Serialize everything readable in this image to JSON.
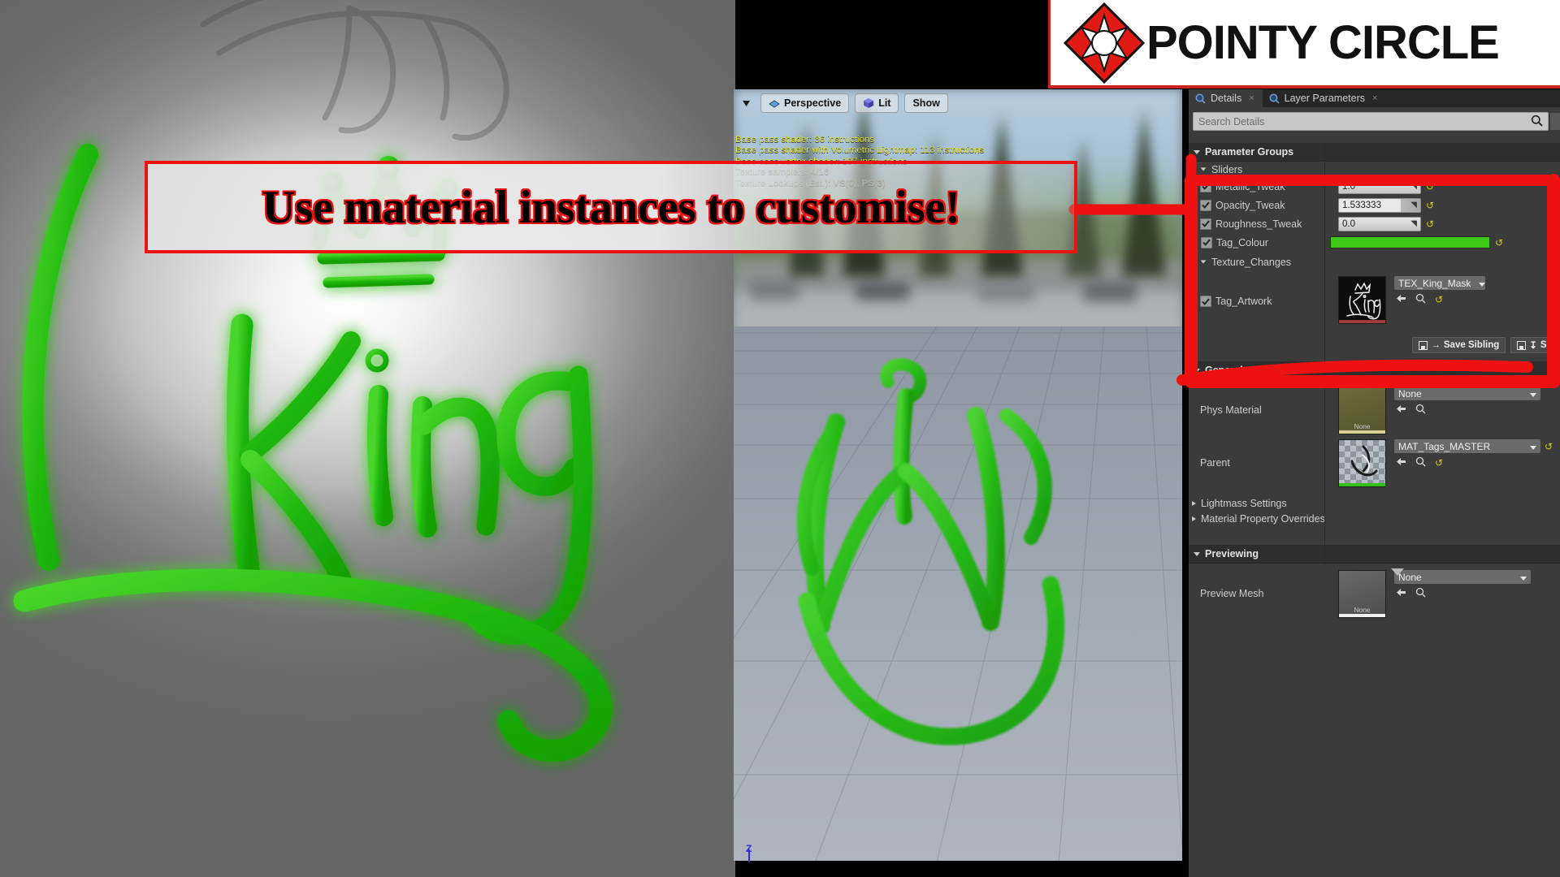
{
  "branding": {
    "company": "POINTY CIRCLE",
    "logo_icon": "pointy-circle-diamond-star-logo"
  },
  "annotation": {
    "banner_text": "Use material instances to customise!",
    "accent_color": "#ee1111",
    "callout_label": "red-highlight-box-around-parameter-groups"
  },
  "viewport": {
    "toolbar": {
      "dropdown_icon": "viewport-options-caret",
      "camera_label": "Perspective",
      "camera_icon": "perspective-camera-icon",
      "lighting_label": "Lit",
      "lighting_icon": "lit-cube-icon",
      "show_label": "Show"
    },
    "stats": [
      {
        "text": "Base pass shader: 86 instructions",
        "dim": false
      },
      {
        "text": "Base pass shader with Volumetric Lightmap: 113 instructions",
        "dim": false
      },
      {
        "text": "Base pass vertex shader: 197 instructions",
        "dim": false
      },
      {
        "text": "Texture samplers: 4/16",
        "dim": true
      },
      {
        "text": "Texture Lookups (Est.): VS(0), PS(3)",
        "dim": true
      }
    ],
    "axis_label": "Z"
  },
  "panel": {
    "tabs": [
      {
        "label": "Details",
        "icon": "search-magnifier-tab-icon",
        "active": true,
        "close": "×"
      },
      {
        "label": "Layer Parameters",
        "icon": "search-magnifier-tab-icon",
        "active": false,
        "close": "×"
      }
    ],
    "search": {
      "placeholder": "Search Details",
      "value": "",
      "icon": "search-icon"
    },
    "sections": {
      "parameter_groups": {
        "title": "Parameter Groups",
        "groups": [
          {
            "title": "Sliders",
            "rows": [
              {
                "label": "Metallic_Tweak",
                "checked": true,
                "type": "number",
                "value": "1.0",
                "fill": 1.0,
                "revert": true
              },
              {
                "label": "Opacity_Tweak",
                "checked": true,
                "type": "number",
                "value": "1.533333",
                "fill": 0.76,
                "revert": true
              },
              {
                "label": "Roughness_Tweak",
                "checked": true,
                "type": "number",
                "value": "0.0",
                "fill": 1.0,
                "revert": true
              }
            ],
            "color_row": {
              "label": "Tag_Colour",
              "checked": true,
              "expandable": true,
              "color": "#3cc716",
              "revert": true
            }
          },
          {
            "title": "Texture_Changes",
            "texture_row": {
              "label": "Tag_Artwork",
              "checked": true,
              "asset_name": "TEX_King_Mask",
              "thumb_name": "king-graffiti-tag-thumbnail",
              "thumb_strip_color": "#9e3b3b",
              "actions": [
                "browse-to-asset-icon",
                "find-in-content-browser-icon",
                "reset-to-default-icon"
              ]
            }
          }
        ],
        "buttons": [
          {
            "label": "Save Sibling",
            "icon": "save-sibling-icon"
          },
          {
            "label": "Sa",
            "icon": "save-child-icon"
          }
        ]
      },
      "general": {
        "title": "General",
        "rows": [
          {
            "label": "Phys Material",
            "thumb_caption": "None",
            "thumb_strip_color": "#d9cf92",
            "thumb_name": "phys-material-thumbnail",
            "value": "None",
            "actions": [
              "browse-to-asset-icon",
              "find-in-content-browser-icon"
            ],
            "revert": false
          },
          {
            "label": "Parent",
            "thumb_caption": "",
            "thumb_strip_color": "#2fc21a",
            "thumb_name": "parent-material-thumbnail",
            "value": "MAT_Tags_MASTER",
            "actions": [
              "browse-to-asset-icon",
              "find-in-content-browser-icon",
              "reset-to-default-icon"
            ],
            "revert": true
          }
        ],
        "collapsed": [
          {
            "label": "Lightmass Settings"
          },
          {
            "label": "Material Property Overrides"
          }
        ]
      },
      "previewing": {
        "title": "Previewing",
        "rows": [
          {
            "label": "Preview Mesh",
            "thumb_caption": "None",
            "thumb_strip_color": "#f0f0f0",
            "thumb_name": "preview-mesh-thumbnail",
            "value": "None",
            "actions": [
              "browse-to-asset-icon",
              "find-in-content-browser-icon"
            ]
          }
        ]
      }
    },
    "scroll_more_icon": "scroll-down-arrow"
  },
  "artwork": {
    "tag_name": "king-graffiti-tag",
    "tag_color": "#2fbe18"
  }
}
